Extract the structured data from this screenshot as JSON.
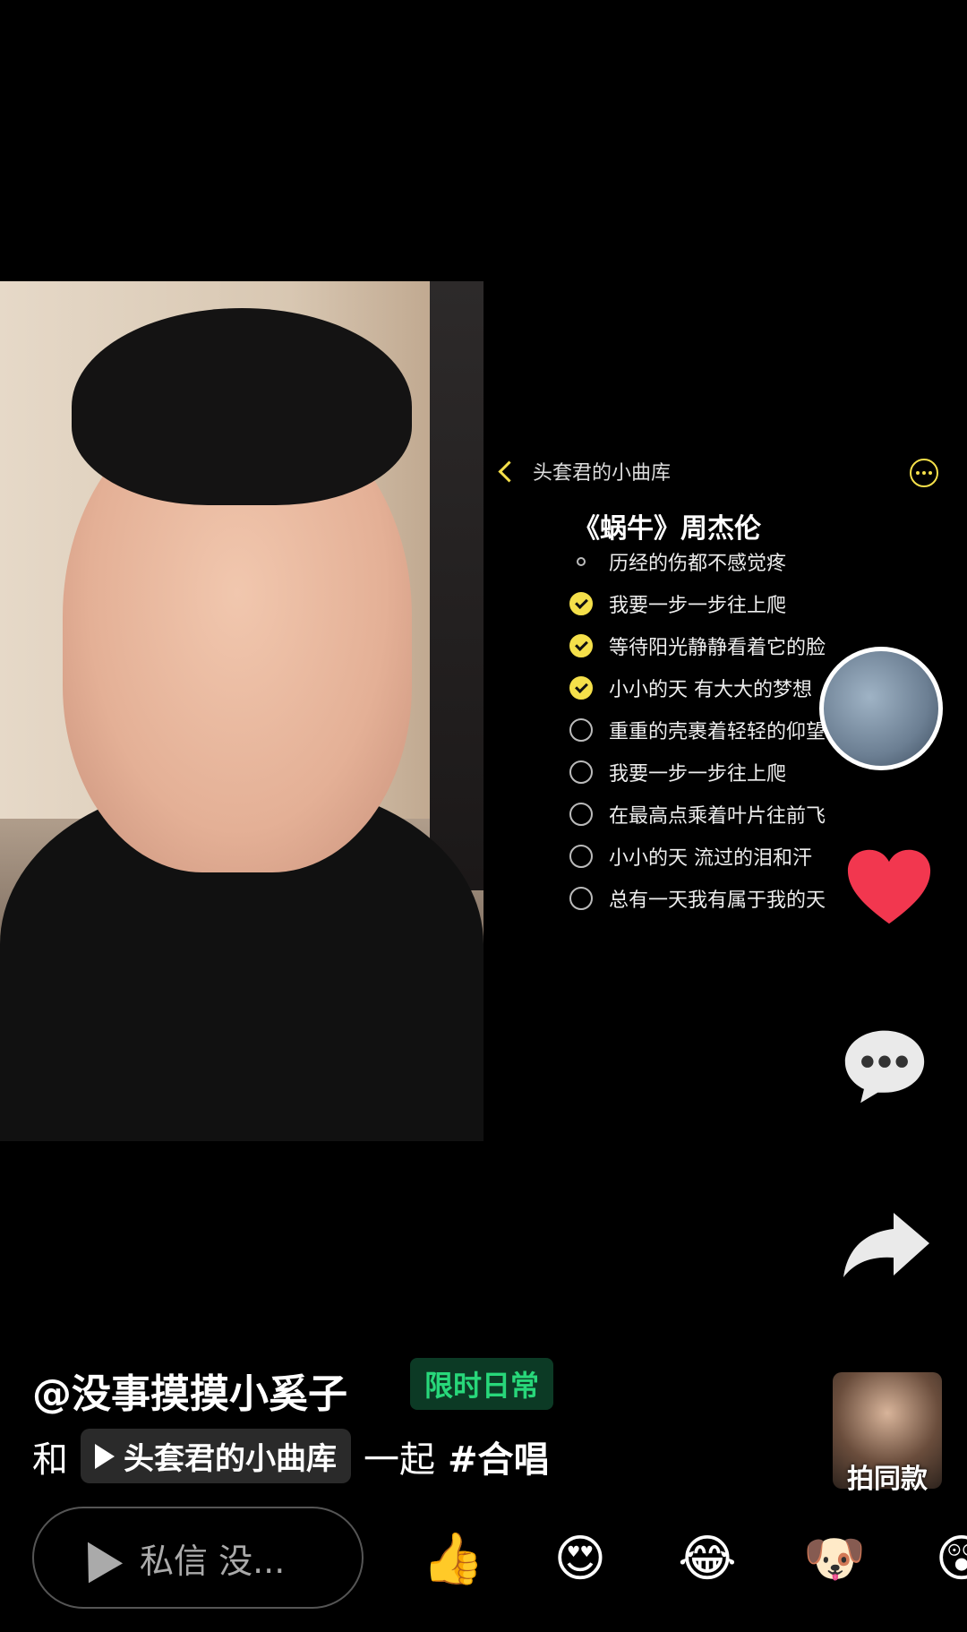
{
  "card": {
    "back_label": "头套君的小曲库",
    "song_title": "《蜗牛》周杰伦",
    "lyrics": [
      {
        "text": "历经的伤都不感觉疼",
        "state": "bullet"
      },
      {
        "text": "我要一步一步往上爬",
        "state": "done"
      },
      {
        "text": "等待阳光静静看着它的脸",
        "state": "done"
      },
      {
        "text": "小小的天 有大大的梦想",
        "state": "done"
      },
      {
        "text": "重重的壳裹着轻轻的仰望",
        "state": "todo"
      },
      {
        "text": "我要一步一步往上爬",
        "state": "todo"
      },
      {
        "text": "在最高点乘着叶片往前飞",
        "state": "todo"
      },
      {
        "text": "小小的天 流过的泪和汗",
        "state": "todo"
      },
      {
        "text": "总有一天我有属于我的天",
        "state": "todo"
      }
    ]
  },
  "right_rail": {
    "sticker_label": "拍同款"
  },
  "caption": {
    "author": "@没事摸摸小奚子",
    "tag": "限时日常",
    "with_word": "和",
    "collab_name": "头套君的小曲库",
    "together": "一起",
    "hashtag": "#合唱"
  },
  "bottom": {
    "dm_placeholder": "私信 没...",
    "emojis": [
      "👍",
      "😍",
      "😂",
      "🐶",
      "😲"
    ]
  },
  "colors": {
    "accent_yellow": "#f5e04a",
    "tag_green": "#28d77a",
    "heart": "#f2374f"
  }
}
